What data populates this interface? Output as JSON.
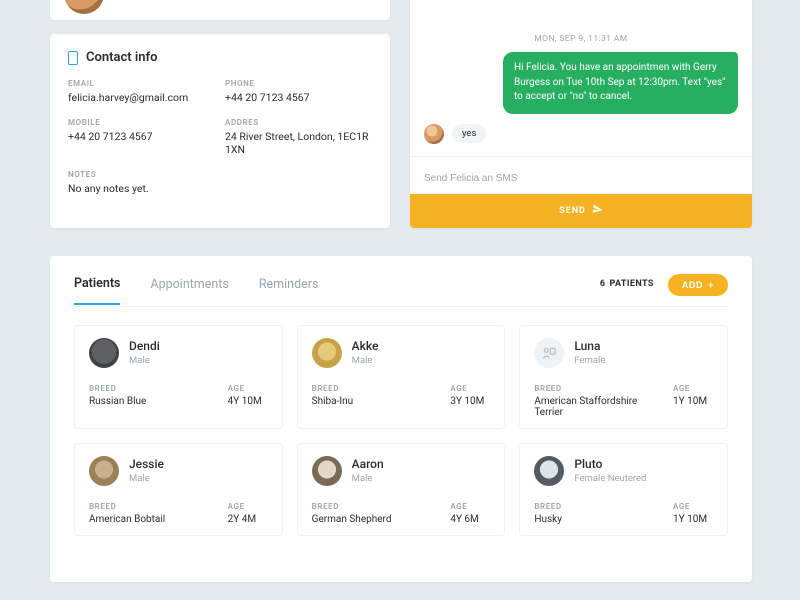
{
  "contact": {
    "title": "Contact info",
    "email_label": "EMAIL",
    "email": "felicia.harvey@gmail.com",
    "phone_label": "PHONE",
    "phone": "+44 20 7123 4567",
    "mobile_label": "MOBILE",
    "mobile": "+44 20 7123 4567",
    "address_label": "ADDRES",
    "address": "24 River Street, London, 1EC1R 1XN",
    "notes_label": "NOTES",
    "notes": "No any notes yet."
  },
  "chat": {
    "date": "MON, SEP 9, 11:31 AM",
    "outgoing": "Hi Felicia. You have an appointmen with Gerry Burgess on Tue 10th Sep at 12:30pm. Text \"yes\" to accept or \"no\" to cancel.",
    "reply": "yes",
    "input_placeholder": "Send Felicia an SMS",
    "send_label": "SEND"
  },
  "tabs": {
    "patients": "Patients",
    "appointments": "Appointments",
    "reminders": "Reminders",
    "count_label": "PATIENTS",
    "count": "6",
    "add_label": "ADD"
  },
  "labels": {
    "breed": "BREED",
    "age": "AGE"
  },
  "patients": [
    {
      "name": "Dendi",
      "gender": "Male",
      "breed": "Russian Blue",
      "age": "4Y 10M",
      "avatar": "av-cat-gray"
    },
    {
      "name": "Akke",
      "gender": "Male",
      "breed": "Shiba-Inu",
      "age": "3Y 10M",
      "avatar": "av-dog-gold"
    },
    {
      "name": "Luna",
      "gender": "Female",
      "breed": "American Staffordshire Terrier",
      "age": "1Y 10M",
      "avatar": "av-placeholder"
    },
    {
      "name": "Jessie",
      "gender": "Male",
      "breed": "American Bobtail",
      "age": "2Y 4M",
      "avatar": "av-cat-tabby"
    },
    {
      "name": "Aaron",
      "gender": "Male",
      "breed": "German Shepherd",
      "age": "4Y 6M",
      "avatar": "av-dog-mix"
    },
    {
      "name": "Pluto",
      "gender": "Female Neutered",
      "breed": "Husky",
      "age": "1Y 10M",
      "avatar": "av-husky"
    }
  ]
}
